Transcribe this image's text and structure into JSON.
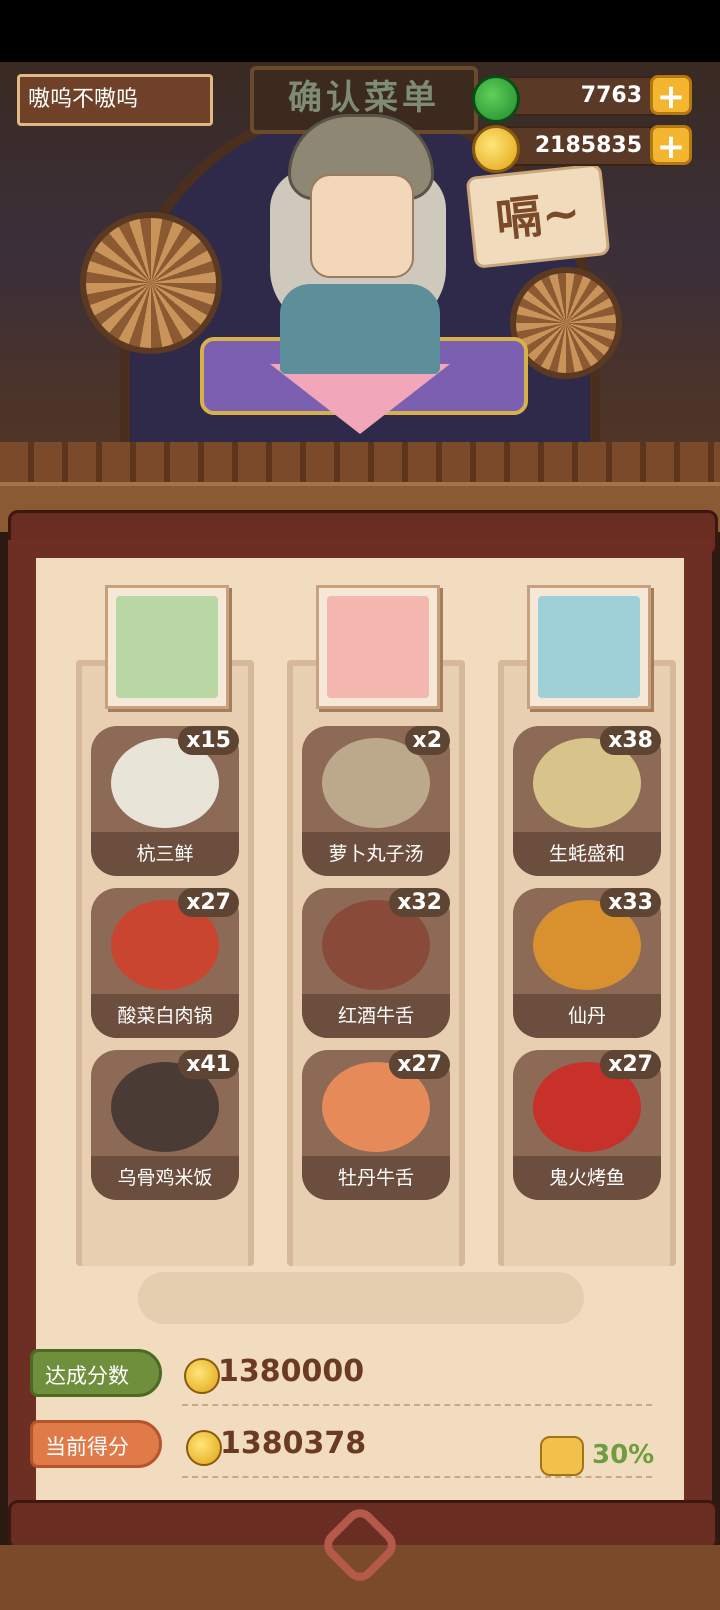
{
  "header": {
    "player_name": "嗷呜不嗷呜",
    "jade_amount": "7763",
    "coin_amount": "2185835",
    "add_label": "+"
  },
  "scene": {
    "sign_text": "确认菜单",
    "speech_text": "嗝~"
  },
  "customers": [
    {
      "name": "customer-1",
      "color": "#b9d7a4"
    },
    {
      "name": "customer-2",
      "color": "#f4b7b0"
    },
    {
      "name": "customer-3",
      "color": "#9fd0d8"
    }
  ],
  "menu": {
    "columns": [
      {
        "dishes": [
          {
            "name": "杭三鲜",
            "count": "x15",
            "color": "#e9e4d8"
          },
          {
            "name": "酸菜白肉锅",
            "count": "x27",
            "color": "#c9452f"
          },
          {
            "name": "乌骨鸡米饭",
            "count": "x41",
            "color": "#4a3b34"
          }
        ]
      },
      {
        "dishes": [
          {
            "name": "萝卜丸子汤",
            "count": "x2",
            "color": "#bca98c"
          },
          {
            "name": "红酒牛舌",
            "count": "x32",
            "color": "#8a4a3a"
          },
          {
            "name": "牡丹牛舌",
            "count": "x27",
            "color": "#e68a5a"
          }
        ]
      },
      {
        "dishes": [
          {
            "name": "生蚝盛和",
            "count": "x38",
            "color": "#d8c48a"
          },
          {
            "name": "仙丹",
            "count": "x33",
            "color": "#d9902f"
          },
          {
            "name": "鬼火烤鱼",
            "count": "x27",
            "color": "#c8302a"
          }
        ]
      }
    ]
  },
  "scores": {
    "target_label": "达成分数",
    "target_value": "1380000",
    "current_label": "当前得分",
    "current_value": "1380378",
    "bonus_percent": "30%"
  }
}
